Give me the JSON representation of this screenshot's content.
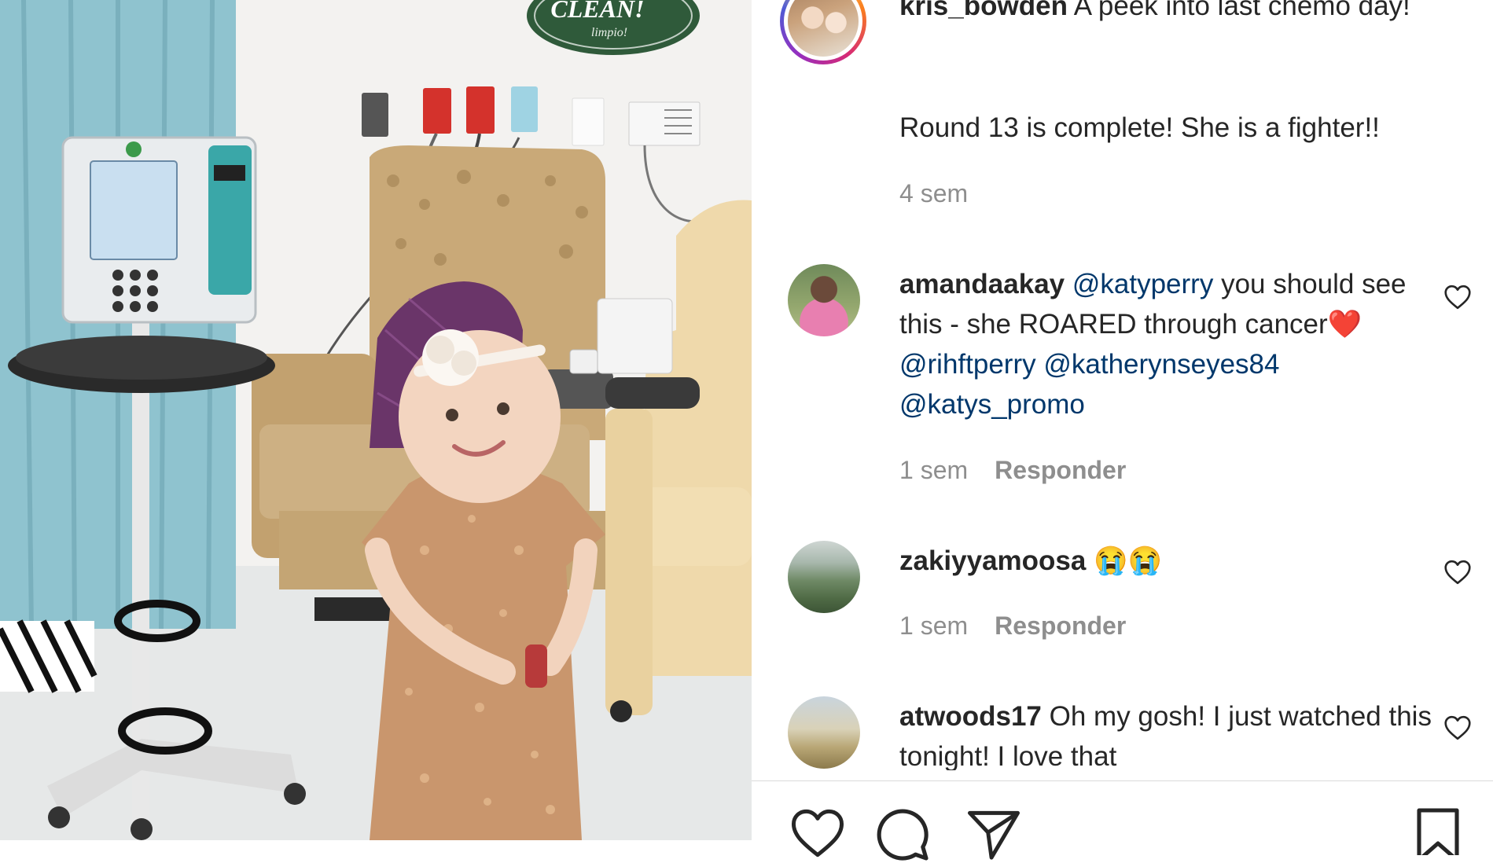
{
  "post": {
    "owner_username": "kris_bowden",
    "caption_line1": "A peek into last chemo day!",
    "caption_line2": "Round 13 is complete! She is a fighter!!",
    "time": "4 sem"
  },
  "comments": [
    {
      "username": "amandaakay",
      "parts": [
        "@katyperry",
        " you should see this - she ROARED through cancer",
        "❤️",
        " ",
        "@rihftperry",
        " ",
        "@katherynseyes84",
        " ",
        "@katys_promo"
      ],
      "time": "1 sem",
      "reply_label": "Responder"
    },
    {
      "username": "zakiyyamoosa",
      "text": "😭😭",
      "time": "1 sem",
      "reply_label": "Responder"
    },
    {
      "username": "atwoods17",
      "text": "Oh my gosh! I just watched this tonight! I love that"
    }
  ],
  "icons": {
    "like": "heart-icon",
    "comment": "comment-icon",
    "share": "paper-plane-icon",
    "save": "bookmark-icon"
  },
  "photo_sign_text": "CLEAN!",
  "photo_sign_subtext": "limpio!",
  "colors": {
    "mention": "#00376b",
    "meta_gray": "#8e8e8e",
    "text": "#262626",
    "divider": "#dbdbdb"
  }
}
